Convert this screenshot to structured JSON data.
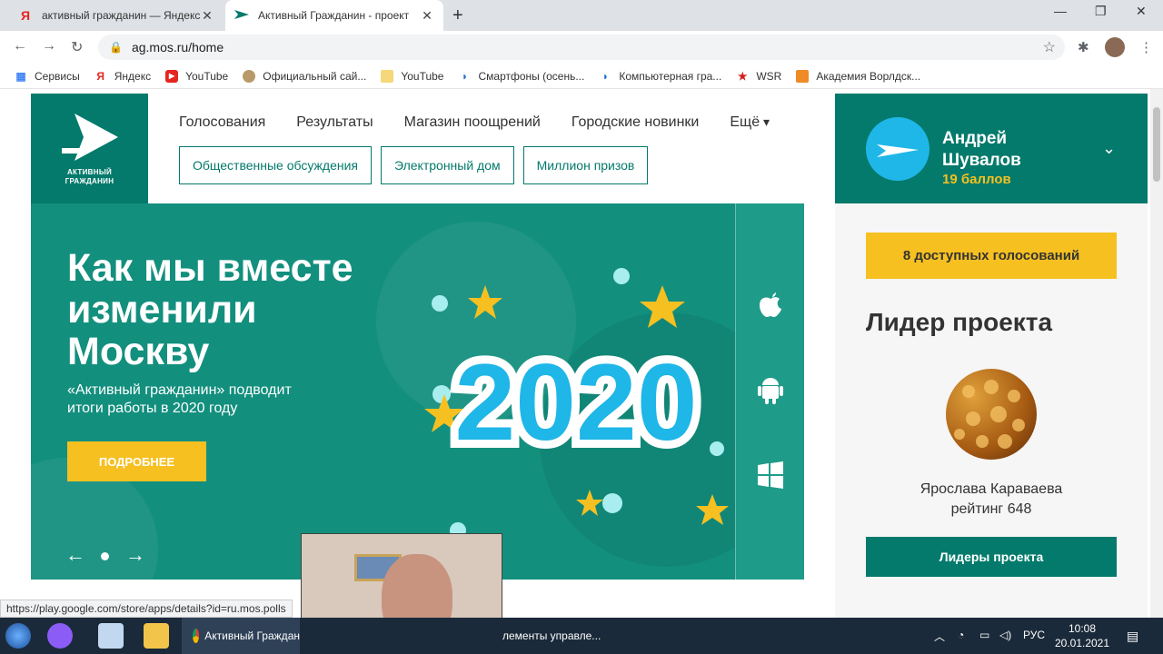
{
  "browser": {
    "tabs": [
      {
        "title": "активный гражданин — Яндекс",
        "favicon": "Я"
      },
      {
        "title": "Активный Гражданин - проект",
        "favicon": "ag-logo"
      }
    ],
    "new_tab": "+",
    "window_controls": {
      "minimize": "—",
      "restore": "❐",
      "close": "✕"
    },
    "url": "ag.mos.ru/home",
    "bookmarks": [
      {
        "label": "Сервисы",
        "icon": "apps-grid-icon"
      },
      {
        "label": "Яндекс",
        "icon": "yandex-icon"
      },
      {
        "label": "YouTube",
        "icon": "youtube-icon"
      },
      {
        "label": "Официальный сай...",
        "icon": "emblem-icon"
      },
      {
        "label": "YouTube",
        "icon": "folder-icon"
      },
      {
        "label": "Смартфоны (осень...",
        "icon": "edge-icon"
      },
      {
        "label": "Компьютерная гра...",
        "icon": "edge-icon"
      },
      {
        "label": "WSR",
        "icon": "star-icon"
      },
      {
        "label": "Академия Ворлдск...",
        "icon": "orange-grid-icon"
      }
    ]
  },
  "site": {
    "logo_caption": [
      "АКТИВНЫЙ",
      "ГРАЖДАНИН"
    ],
    "nav": [
      "Голосования",
      "Результаты",
      "Магазин поощрений",
      "Городские новинки",
      "Ещё"
    ],
    "pills": [
      "Общественные обсуждения",
      "Электронный дом",
      "Миллион призов"
    ],
    "banner": {
      "title_lines": [
        "Как мы вместе",
        "изменили",
        "Москву"
      ],
      "subtitle_lines": [
        "«Активный гражданин» подводит",
        "итоги работы в 2020 году"
      ],
      "button": "ПОДРОБНЕЕ",
      "art_text": "2020",
      "prev": "←",
      "next": "→"
    },
    "app_icons": [
      "apple-icon",
      "android-icon",
      "windows-icon"
    ],
    "user": {
      "name_lines": [
        "Андрей",
        "Шувалов"
      ],
      "points": "19 баллов"
    },
    "votes_button": "8 доступных голосований",
    "leader_heading": "Лидер проекта",
    "leader_name": "Ярослава Караваева",
    "leader_rating": "рейтинг 648",
    "leaders_button": "Лидеры проекта"
  },
  "status_url": "https://play.google.com/store/apps/details?id=ru.mos.polls",
  "taskbar": {
    "items": [
      "Активный Граждан",
      "лементы управле..."
    ],
    "lang": "РУС",
    "time": "10:08",
    "date": "20.01.2021"
  },
  "colors": {
    "brand": "#037a6b",
    "banner": "#138f7e",
    "accent": "#f6c021"
  }
}
